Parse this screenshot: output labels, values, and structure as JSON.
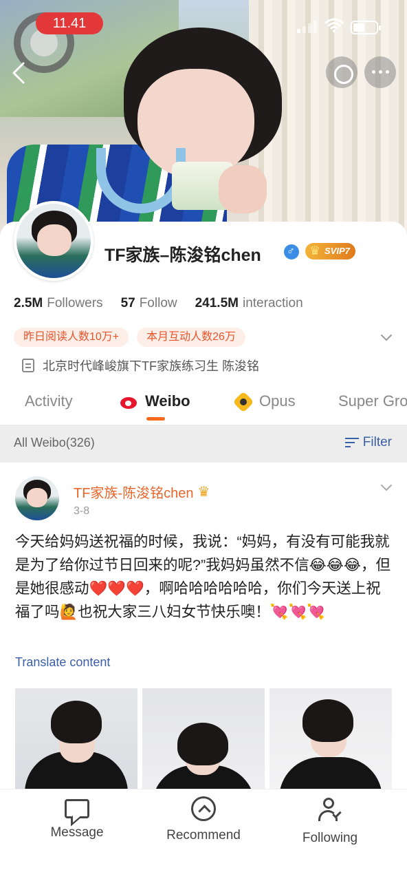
{
  "status_bar": {
    "time": "11.41"
  },
  "profile": {
    "name": "TF家族–陈浚铭chen",
    "gender": "male",
    "vip_badge": "SVIP7",
    "stats": [
      {
        "value": "2.5M",
        "label": "Followers"
      },
      {
        "value": "57",
        "label": "Follow"
      },
      {
        "value": "241.5M",
        "label": "interaction"
      }
    ],
    "tags": [
      "昨日阅读人数10万+",
      "本月互动人数26万"
    ],
    "bio": "北京时代峰峻旗下TF家族练习生  陈浚铭"
  },
  "tabs": [
    {
      "label": "Activity",
      "icon": "none",
      "active": false
    },
    {
      "label": "Weibo",
      "icon": "weibo-icon",
      "active": true
    },
    {
      "label": "Opus",
      "icon": "opus-icon",
      "active": false
    },
    {
      "label": "Super Gro",
      "icon": "none",
      "active": false
    }
  ],
  "filter_bar": {
    "count_label": "All Weibo(326)",
    "filter_label": "Filter"
  },
  "post": {
    "author": "TF家族-陈浚铭chen",
    "date": "3-8",
    "text": "今天给妈妈送祝福的时候，我说：“妈妈，有没有可能我就是为了给你过节日回来的呢?”我妈妈虽然不信😂😂😂，但是她很感动❤️❤️❤️，啊哈哈哈哈哈哈，你们今天送上祝福了吗🙋也祝大家三八妇女节快乐噢！💘💘💘",
    "translate_label": "Translate content",
    "photo_count": 3
  },
  "bottom_nav": [
    {
      "label": "Message",
      "icon": "message-icon"
    },
    {
      "label": "Recommend",
      "icon": "recommend-icon"
    },
    {
      "label": "Following",
      "icon": "following-icon"
    }
  ],
  "colors": {
    "accent": "#f56b1b",
    "link": "#3a5ea8",
    "author": "#e8662c",
    "tag_text": "#e8552c"
  }
}
